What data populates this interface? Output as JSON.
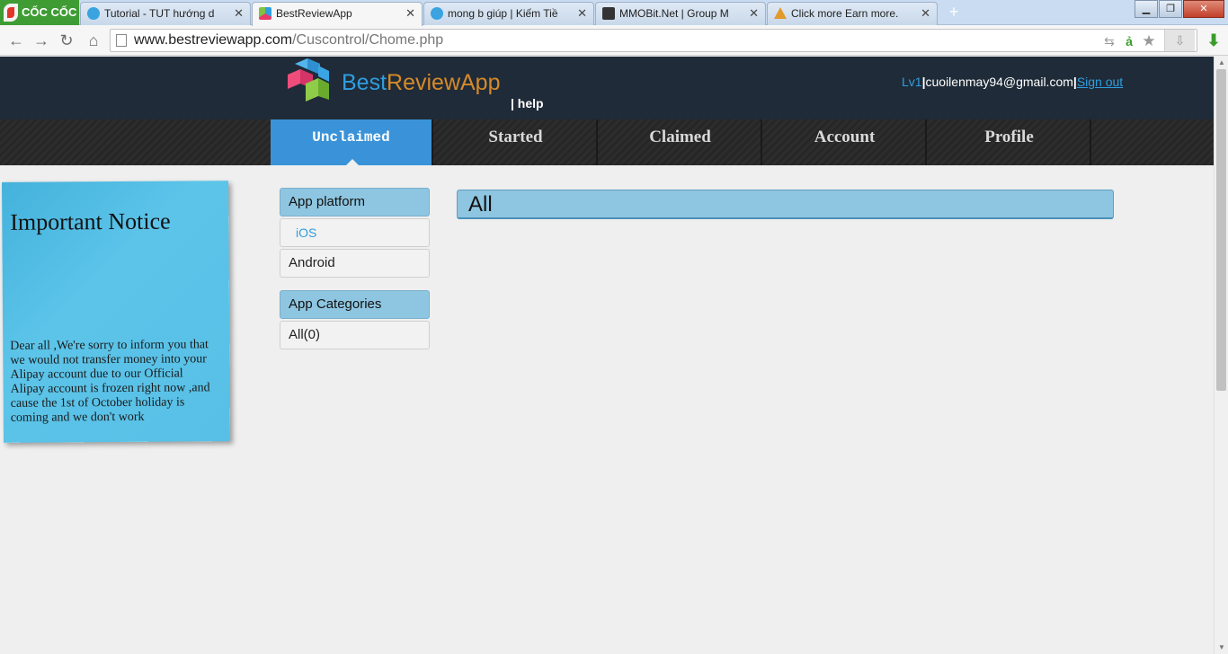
{
  "browser": {
    "brand": "CỐC CỐC",
    "tabs": [
      {
        "title": "Tutorial - TUT hướng dẫn",
        "active": false
      },
      {
        "title": "BestReviewApp",
        "active": true
      },
      {
        "title": "mong b giúp | Kiếm Tiền T",
        "active": false
      },
      {
        "title": "MMOBit.Net | Group Make",
        "active": false
      },
      {
        "title": "Click more Earn more.",
        "active": false
      }
    ],
    "new_tab_label": "+",
    "url_host": "www.bestreviewapp.com",
    "url_path": "/Cuscontrol/Chome.php"
  },
  "header": {
    "logo_best": "Best",
    "logo_rest": "ReviewApp",
    "help": "| help",
    "level": "Lv1",
    "separator": "|",
    "email": "cuoilenmay94@gmail.com",
    "signout": "Sign out"
  },
  "nav": {
    "tabs": [
      {
        "label": "Unclaimed",
        "active": true
      },
      {
        "label": "Started",
        "active": false
      },
      {
        "label": "Claimed",
        "active": false
      },
      {
        "label": "Account",
        "active": false
      },
      {
        "label": "Profile",
        "active": false
      }
    ]
  },
  "notice": {
    "title": "Important Notice",
    "body": "Dear all ,We're sorry to inform you that we would not transfer money into your Alipay account due to our Official Alipay account is frozen right now ,and cause the 1st of October holiday is coming and we don't work"
  },
  "filters": {
    "platform_head": "App platform",
    "platforms": [
      {
        "label": "iOS",
        "active": true
      },
      {
        "label": "Android",
        "active": false
      }
    ],
    "categories_head": "App Categories",
    "categories": [
      {
        "label": "All(0)"
      }
    ]
  },
  "main": {
    "heading": "All"
  },
  "colors": {
    "accent": "#3a93d8",
    "header_bg": "#1f2b38",
    "notice_bg": "#58c0e6",
    "filter_head_bg": "#8ec5e0"
  }
}
